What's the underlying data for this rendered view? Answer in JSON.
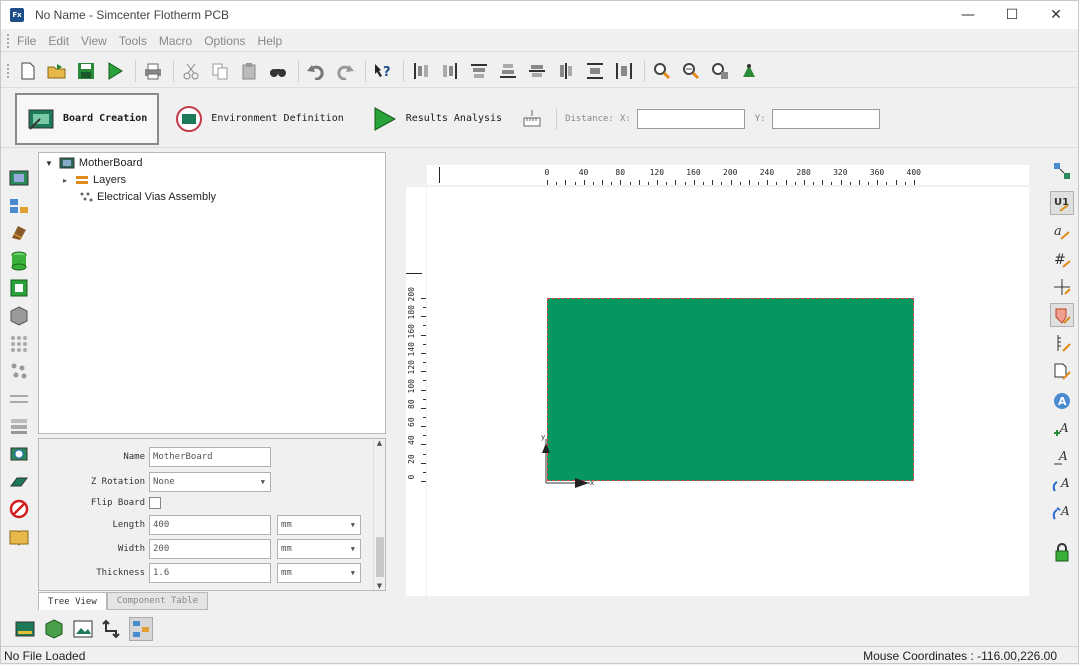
{
  "window": {
    "app_logo": "Fx",
    "title": "No Name - Simcenter Flotherm PCB",
    "controls": [
      "—",
      "☐",
      "✕"
    ]
  },
  "menu": [
    "File",
    "Edit",
    "View",
    "Tools",
    "Macro",
    "Options",
    "Help"
  ],
  "toolbar": {
    "icons": [
      "new-file-icon",
      "open-folder-icon",
      "save-icon",
      "run-icon",
      "print-icon",
      "cut-icon",
      "copy-icon",
      "paste-icon",
      "find-icon",
      "undo-icon",
      "redo-icon",
      "help-icon",
      "align-left-icon",
      "align-right-icon",
      "align-top-icon",
      "align-bottom-icon",
      "center-vertical-icon",
      "center-horizontal-icon",
      "distribute-vertical-icon",
      "distribute-horizontal-icon",
      "zoom-in-icon",
      "zoom-out-icon",
      "zoom-fit-icon",
      "origin-icon"
    ]
  },
  "workflow": {
    "board_creation": "Board Creation",
    "environment_definition": "Environment Definition",
    "results_analysis": "Results Analysis",
    "distance_label": "Distance:",
    "x_label": "X:",
    "y_label": "Y:",
    "x_value": "",
    "y_value": ""
  },
  "tree": {
    "root": "MotherBoard",
    "children": [
      "Layers",
      "Electrical Vias Assembly"
    ]
  },
  "properties": {
    "name_label": "Name",
    "name_value": "MotherBoard",
    "rotation_label": "Z Rotation",
    "rotation_value": "None",
    "flip_label": "Flip Board",
    "length_label": "Length",
    "length_value": "400",
    "length_unit": "mm",
    "width_label": "Width",
    "width_value": "200",
    "width_unit": "mm",
    "thickness_label": "Thickness",
    "thickness_value": "1.6",
    "thickness_unit": "mm"
  },
  "tabs": [
    "Tree View",
    "Component Table"
  ],
  "ruler": {
    "horizontal": [
      "0",
      "40",
      "80",
      "120",
      "160",
      "200",
      "240",
      "280",
      "320",
      "360",
      "400"
    ],
    "vertical": [
      "0",
      "20",
      "40",
      "60",
      "80",
      "100",
      "120",
      "140",
      "160",
      "180",
      "200"
    ]
  },
  "canvas": {
    "board_color": "#069660",
    "x_axis_label": "x",
    "y_axis_label": "y"
  },
  "status": {
    "left": "No File Loaded",
    "right": "Mouse Coordinates : -116.00,226.00"
  }
}
